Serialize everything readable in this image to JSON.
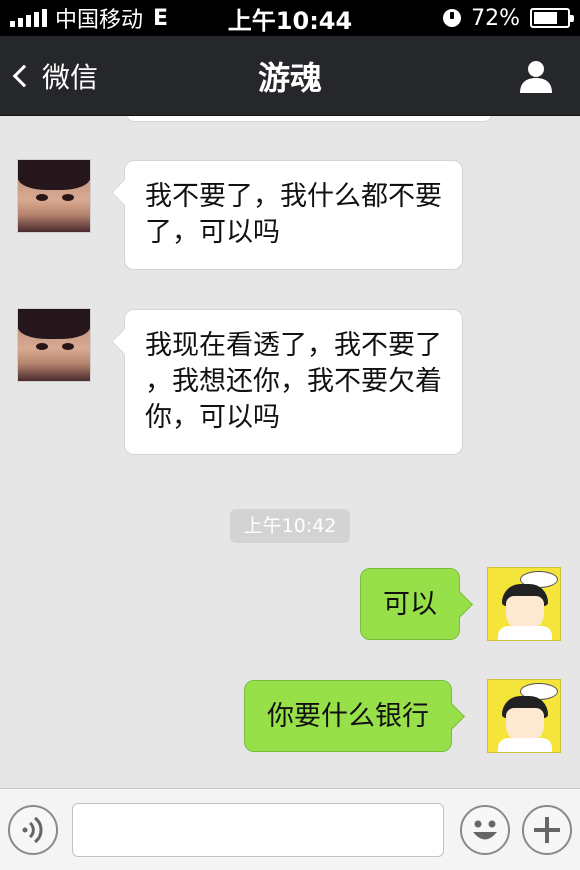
{
  "status_bar": {
    "carrier": "中国移动",
    "network": "E",
    "time": "上午10:44",
    "battery": "72%",
    "battery_level": 0.72
  },
  "nav": {
    "back_label": "微信",
    "title": "游魂",
    "profile_icon": "person-icon"
  },
  "messages": [
    {
      "side": "left",
      "lines": [
        "我不要了，我什么都不要",
        "了，可以吗"
      ]
    },
    {
      "side": "left",
      "lines": [
        "我现在看透了，我不要了",
        "，我想还你，我不要欠着",
        "你，可以吗"
      ]
    },
    {
      "side": "right",
      "text": "可以"
    },
    {
      "side": "right",
      "text": "你要什么银行"
    }
  ],
  "timestamp": "上午10:42",
  "input_bar": {
    "voice_icon": "voice-icon",
    "input_value": "",
    "emoji_icon": "smiley-icon",
    "more_icon": "plus-icon"
  },
  "colors": {
    "status_bg": "#000000",
    "nav_bg": "#25272a",
    "chat_bg": "#e6e6e6",
    "sent_bubble": "#97e04a",
    "received_bubble": "#ffffff"
  }
}
